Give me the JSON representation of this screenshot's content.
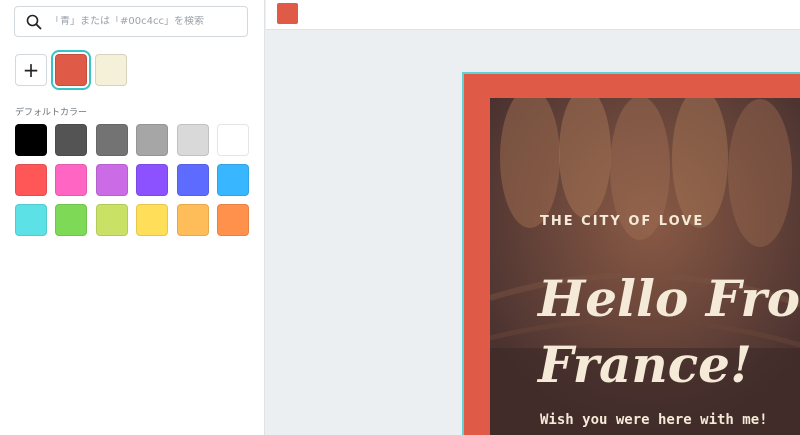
{
  "search": {
    "placeholder": "「青」または「#00c4cc」を検索"
  },
  "document_colors": {
    "add_label": "+",
    "swatches": [
      "#e05a48",
      "#f5f0d8"
    ],
    "selected": "#e05a48"
  },
  "default_colors": {
    "label": "デフォルトカラー",
    "swatches": [
      "#000000",
      "#545454",
      "#737373",
      "#a6a6a6",
      "#d9d9d9",
      "#ffffff",
      "#ff5757",
      "#ff66c4",
      "#cb6ce6",
      "#8c52ff",
      "#5e6bff",
      "#38b6ff",
      "#5ce1e6",
      "#7ed957",
      "#c9e265",
      "#ffde59",
      "#ffbd59",
      "#ff914d"
    ]
  },
  "toolbar": {
    "current_color": "#e05a48"
  },
  "design": {
    "tagline": "THE CITY OF LOVE",
    "headline_line1": "Hello From",
    "headline_line2": "France!",
    "subline": "Wish you were here with me!",
    "frame_color": "#e05a48",
    "text_color": "#f5ead8"
  }
}
